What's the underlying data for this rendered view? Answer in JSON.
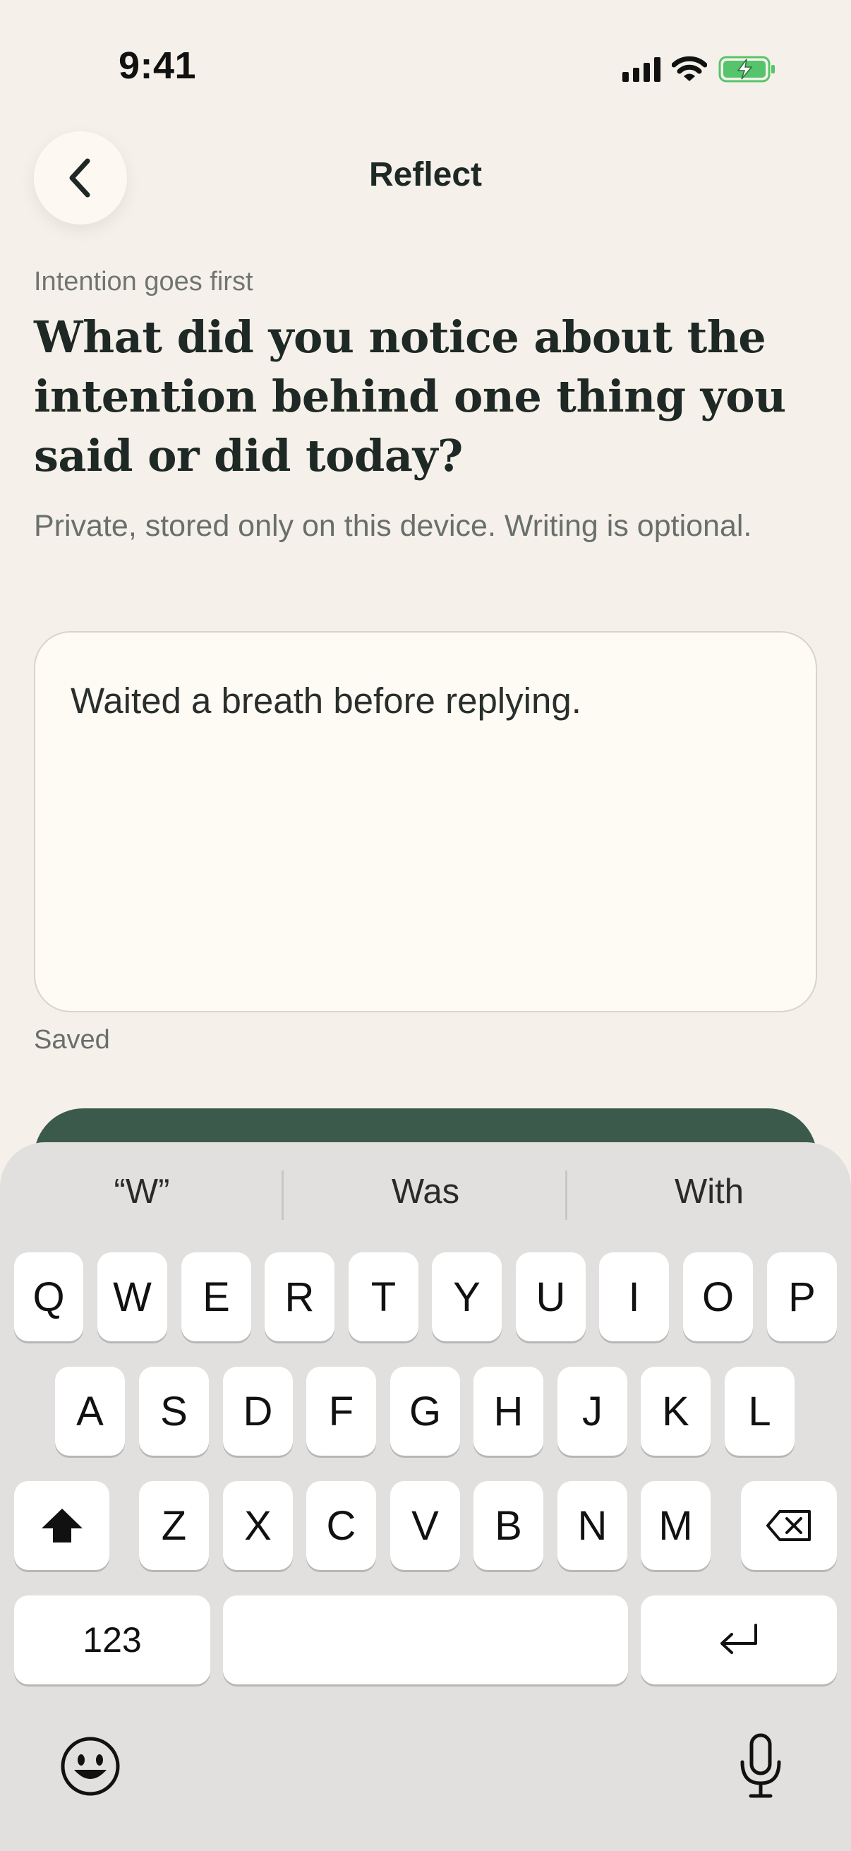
{
  "status_bar": {
    "time": "9:41",
    "icons": [
      "signal-icon",
      "wifi-icon",
      "battery-charging-icon"
    ]
  },
  "header": {
    "title": "Reflect",
    "back_icon": "chevron-left-icon"
  },
  "prompt": {
    "eyebrow": "Intention goes first",
    "question": "What did you notice about the intention behind one thing you said or did today?",
    "note": "Private, stored only on this device. Writing is optional."
  },
  "entry": {
    "value": "Waited a breath before replying."
  },
  "save_status": "Saved",
  "keyboard": {
    "suggestions": [
      "“W”",
      "Was",
      "With"
    ],
    "row1": [
      "Q",
      "W",
      "E",
      "R",
      "T",
      "Y",
      "U",
      "I",
      "O",
      "P"
    ],
    "row2": [
      "A",
      "S",
      "D",
      "F",
      "G",
      "H",
      "J",
      "K",
      "L"
    ],
    "row3": [
      "Z",
      "X",
      "C",
      "V",
      "B",
      "N",
      "M"
    ],
    "numbers_key": "123",
    "icons": [
      "shift-icon",
      "delete-icon",
      "return-icon",
      "emoji-icon",
      "microphone-icon"
    ]
  },
  "colors": {
    "background": "#F5F1EA",
    "accent": "#3C5A4B",
    "text": "#1E2824",
    "keyboard": "#E1E0DE"
  }
}
